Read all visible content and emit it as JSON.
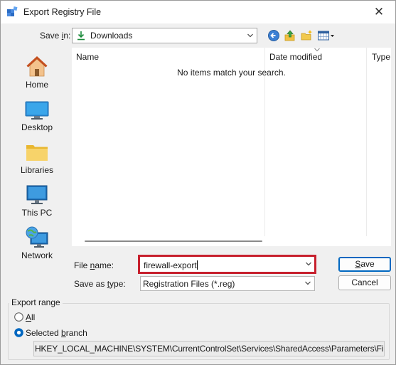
{
  "window": {
    "title": "Export Registry File",
    "close_glyph": "✕",
    "app_icon": "registry-icon"
  },
  "save_in": {
    "label_prefix": "Save ",
    "label_accel": "i",
    "label_suffix": "n:",
    "value": "Downloads",
    "icon": "download-arrow-icon"
  },
  "toolbar": {
    "icons": [
      "back-icon",
      "up-folder-icon",
      "new-folder-icon",
      "view-menu-icon"
    ]
  },
  "places": [
    {
      "label": "Home",
      "icon": "home-icon"
    },
    {
      "label": "Desktop",
      "icon": "desktop-icon"
    },
    {
      "label": "Libraries",
      "icon": "libraries-icon"
    },
    {
      "label": "This PC",
      "icon": "this-pc-icon"
    },
    {
      "label": "Network",
      "icon": "network-icon"
    }
  ],
  "file_list": {
    "columns": [
      "Name",
      "Date modified",
      "Type"
    ],
    "empty_message": "No items match your search."
  },
  "file_name": {
    "label_prefix": "File ",
    "label_accel": "n",
    "label_suffix": "ame:",
    "value": "firewall-export"
  },
  "save_as_type": {
    "label_prefix": "Save as ",
    "label_accel": "t",
    "label_suffix": "ype:",
    "value": "Registration Files (*.reg)"
  },
  "buttons": {
    "save_accel": "S",
    "save_rest": "ave",
    "cancel": "Cancel"
  },
  "export_range": {
    "title": "Export range",
    "all_accel": "A",
    "all_rest": "ll",
    "selected_prefix": "Selected ",
    "selected_accel": "b",
    "selected_suffix": "ranch",
    "selected": "selected-branch",
    "branch_path": "HKEY_LOCAL_MACHINE\\SYSTEM\\CurrentControlSet\\Services\\SharedAccess\\Parameters\\FirewallP"
  },
  "colors": {
    "highlight_border": "#c7202d",
    "accent": "#0067c0"
  }
}
